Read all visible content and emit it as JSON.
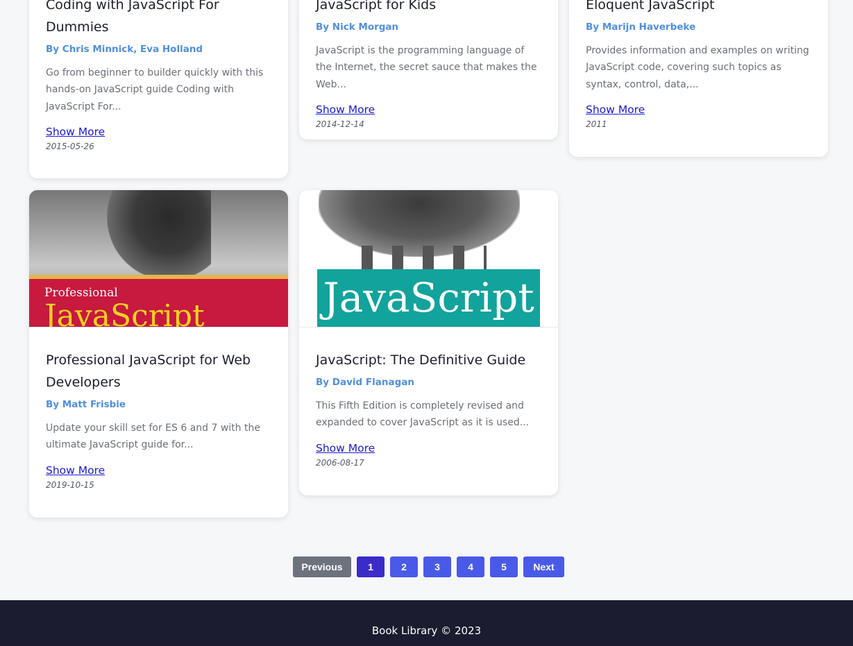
{
  "books": [
    {
      "title": "Coding with JavaScript For Dummies",
      "author": "By Chris Minnick, Eva Holland",
      "description": "Go from beginner to builder quickly with this hands-on JavaScript guide Coding with JavaScript For...",
      "show_more": "Show More",
      "date": "2015-05-26"
    },
    {
      "title": "JavaScript for Kids",
      "author": "By Nick Morgan",
      "description": "JavaScript is the programming language of the Internet, the secret sauce that makes the Web...",
      "show_more": "Show More",
      "date": "2014-12-14"
    },
    {
      "title": "Eloquent JavaScript",
      "author": "By Marijn Haverbeke",
      "description": "Provides information and examples on writing JavaScript code, covering such topics as syntax, control, data,...",
      "show_more": "Show More",
      "date": "2011"
    },
    {
      "title": "Professional JavaScript for Web Developers",
      "author": "By Matt Frisbie",
      "description": "Update your skill set for ES 6 and 7 with the ultimate JavaScript guide for...",
      "show_more": "Show More",
      "date": "2019-10-15",
      "cover_text": [
        "Professional",
        "JavaScript"
      ]
    },
    {
      "title": "JavaScript: The Definitive Guide",
      "author": "By David Flanagan",
      "description": "This Fifth Edition is completely revised and expanded to cover JavaScript as it is used...",
      "show_more": "Show More",
      "date": "2006-08-17",
      "cover_text": [
        "JavaScript"
      ]
    }
  ],
  "pagination": {
    "previous": "Previous",
    "pages": [
      "1",
      "2",
      "3",
      "4",
      "5"
    ],
    "current": "1",
    "next": "Next"
  },
  "footer": {
    "text": "Book Library © 2023"
  },
  "colors": {
    "author": "#4f8fe0",
    "link": "#1a1ad1",
    "page_button": "#4a5ae8",
    "page_active": "#3b2bc8",
    "page_previous": "#6c737d",
    "footer_bg": "#1b1c2f"
  }
}
